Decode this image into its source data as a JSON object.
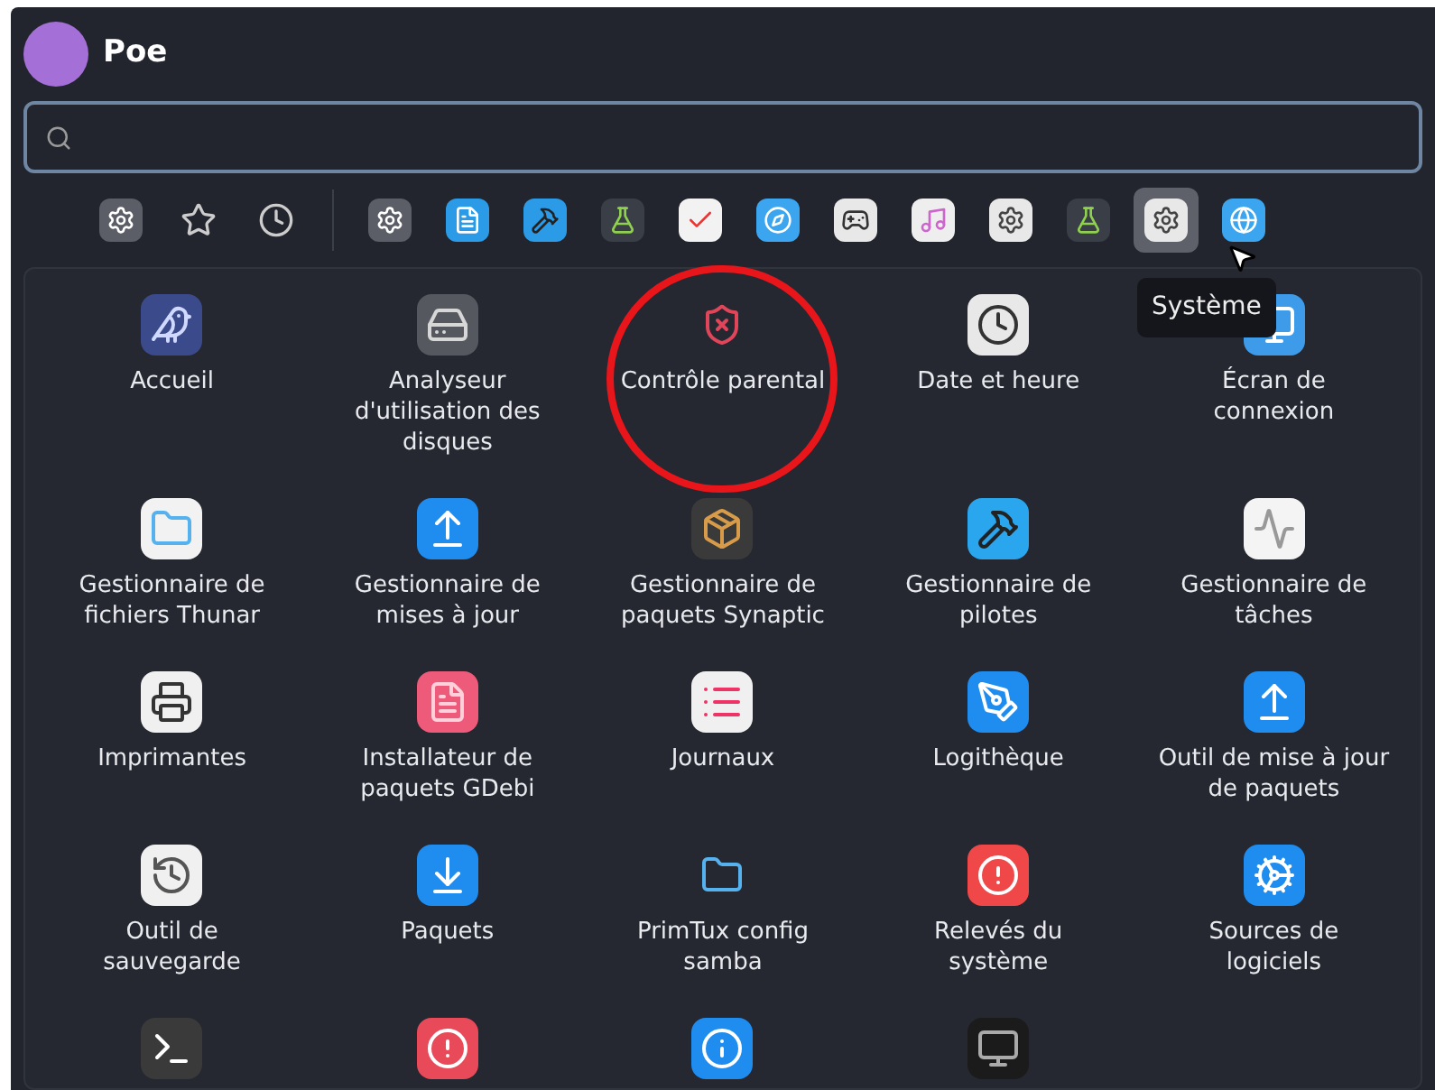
{
  "user": {
    "name": "Poe"
  },
  "categories": [
    {
      "kind": "all",
      "selected": false
    },
    {
      "kind": "favorites",
      "selected": false
    },
    {
      "kind": "recent",
      "selected": false
    },
    {
      "kind": "app",
      "selected": false
    },
    {
      "kind": "app",
      "selected": false
    },
    {
      "kind": "app",
      "selected": false
    },
    {
      "kind": "app",
      "selected": false
    },
    {
      "kind": "app",
      "selected": false
    },
    {
      "kind": "app",
      "selected": false
    },
    {
      "kind": "app",
      "selected": false
    },
    {
      "kind": "app",
      "selected": false
    },
    {
      "kind": "app",
      "selected": false
    },
    {
      "kind": "app",
      "selected": false
    },
    {
      "kind": "app",
      "selected": true
    },
    {
      "kind": "app",
      "selected": false
    }
  ],
  "tooltip": "Système",
  "apps": [
    {
      "label": "Accueil"
    },
    {
      "label": "Analyseur d'utilisation des disques"
    },
    {
      "label": "Contrôle parental",
      "circled": true
    },
    {
      "label": "Date et heure"
    },
    {
      "label": "Écran de connexion"
    },
    {
      "label": "Gestionnaire de fichiers Thunar"
    },
    {
      "label": "Gestionnaire de mises à jour"
    },
    {
      "label": "Gestionnaire de paquets Synaptic"
    },
    {
      "label": "Gestionnaire de pilotes"
    },
    {
      "label": "Gestionnaire de tâches"
    },
    {
      "label": "Imprimantes"
    },
    {
      "label": "Installateur de paquets GDebi"
    },
    {
      "label": "Journaux"
    },
    {
      "label": "Logithèque"
    },
    {
      "label": "Outil de mise à jour de paquets"
    },
    {
      "label": "Outil de sauvegarde"
    },
    {
      "label": "Paquets"
    },
    {
      "label": "PrimTux config samba"
    },
    {
      "label": "Relevés du système"
    },
    {
      "label": "Sources de logiciels"
    }
  ],
  "apps_cut": [
    {
      "kind": "terminal"
    },
    {
      "kind": "alert"
    },
    {
      "kind": "info"
    },
    {
      "kind": "monitor"
    }
  ]
}
